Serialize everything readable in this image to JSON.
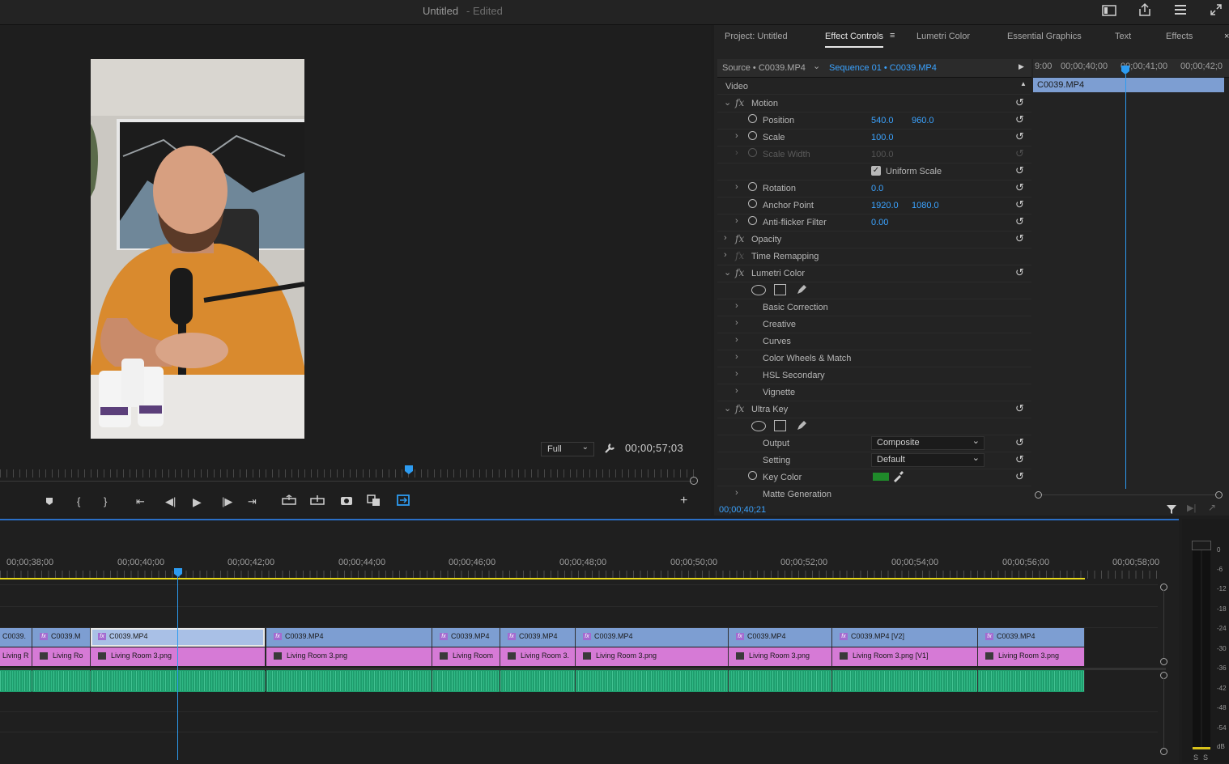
{
  "window": {
    "title": "Untitled",
    "title_suffix": "- Edited"
  },
  "program_monitor": {
    "fit": "Full",
    "timecode": "00;00;57;03"
  },
  "effect_controls": {
    "tabs": [
      "Project: Untitled",
      "Effect Controls",
      "Lumetri Color",
      "Essential Graphics",
      "Text",
      "Effects"
    ],
    "active_tab": "Effect Controls",
    "source": "Source • C0039.MP4",
    "sequence": "Sequence 01 • C0039.MP4",
    "section": "Video",
    "mini_ruler": [
      "9:00",
      "00;00;40;00",
      "00;00;41;00",
      "00;00;42;0"
    ],
    "mini_clip": "C0039.MP4",
    "current_time": "00;00;40;21",
    "rows": {
      "motion": "Motion",
      "position": {
        "label": "Position",
        "x": "540.0",
        "y": "960.0"
      },
      "scale": {
        "label": "Scale",
        "value": "100.0"
      },
      "scale_width": {
        "label": "Scale Width",
        "value": "100.0"
      },
      "uniform_scale": "Uniform Scale",
      "rotation": {
        "label": "Rotation",
        "value": "0.0"
      },
      "anchor_point": {
        "label": "Anchor Point",
        "x": "1920.0",
        "y": "1080.0"
      },
      "anti_flicker": {
        "label": "Anti-flicker Filter",
        "value": "0.00"
      },
      "opacity": "Opacity",
      "time_remapping": "Time Remapping",
      "lumetri": "Lumetri Color",
      "lumetri_items": [
        "Basic Correction",
        "Creative",
        "Curves",
        "Color Wheels & Match",
        "HSL Secondary",
        "Vignette"
      ],
      "ultra_key": "Ultra Key",
      "output": {
        "label": "Output",
        "value": "Composite"
      },
      "setting": {
        "label": "Setting",
        "value": "Default"
      },
      "key_color": {
        "label": "Key Color",
        "color": "#1f8a2a"
      },
      "matte_generation": "Matte Generation"
    }
  },
  "timeline": {
    "ruler": [
      "00;00;38;00",
      "00;00;40;00",
      "00;00;42;00",
      "00;00;44;00",
      "00;00;46;00",
      "00;00;48;00",
      "00;00;50;00",
      "00;00;52;00",
      "00;00;54;00",
      "00;00;56;00",
      "00;00;58;00"
    ],
    "v2_clips": [
      "C0039.",
      "C0039.M",
      "C0039.MP4",
      "C0039.MP4",
      "C0039.MP4",
      "C0039.MP4",
      "C0039.MP4",
      "C0039.MP4",
      "C0039.MP4 [V2]",
      "C0039.MP4"
    ],
    "v1_clips": [
      "Living R",
      "Living Ro",
      "Living Room 3.png",
      "Living Room 3.png",
      "Living Room",
      "Living Room 3.",
      "Living Room 3.png",
      "Living Room 3.png",
      "Living Room 3.png [V1]",
      "Living Room 3.png"
    ]
  },
  "meter": {
    "labels": [
      "0",
      "-6",
      "-12",
      "-18",
      "-24",
      "-30",
      "-36",
      "-42",
      "-48",
      "-54",
      "dB"
    ],
    "solo": [
      "S",
      "S"
    ]
  }
}
